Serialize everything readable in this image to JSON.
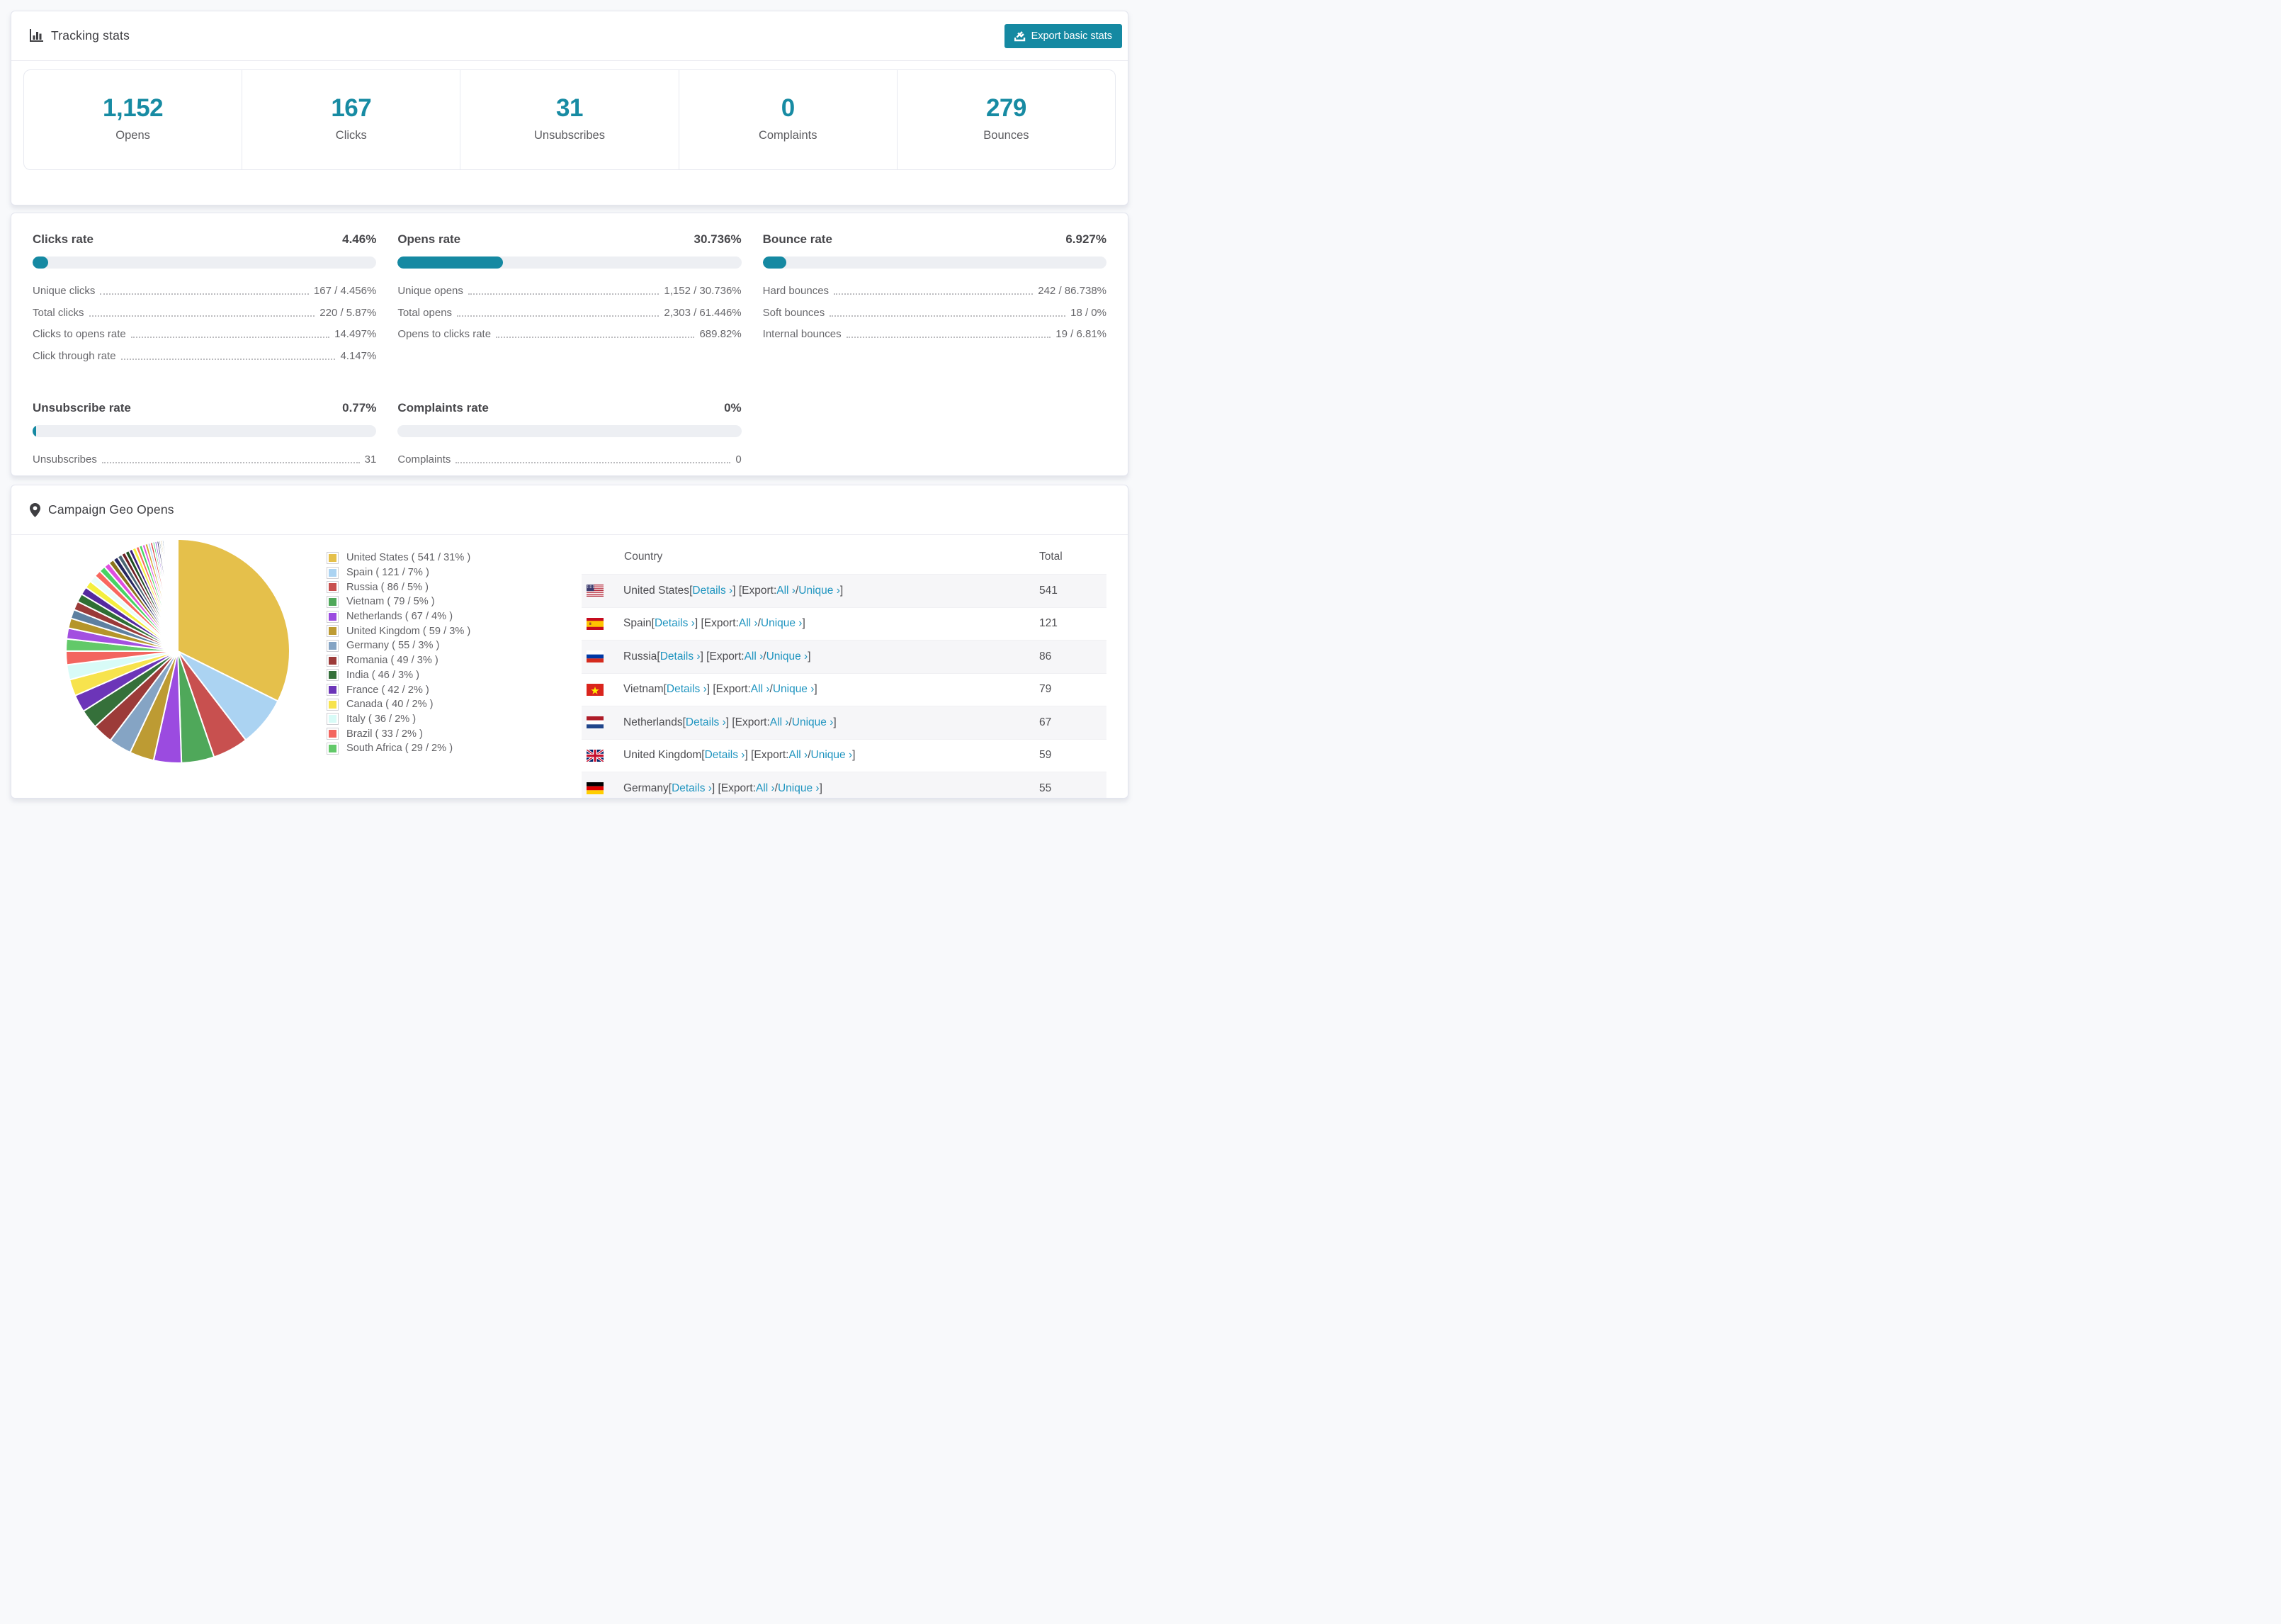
{
  "colors": {
    "accent": "#1589a2",
    "link": "#2095c0",
    "bar_track": "#edeff3",
    "page_bg": "#f8f9fb"
  },
  "tracking": {
    "title": "Tracking stats",
    "export_button": "Export basic stats",
    "stats": [
      {
        "value": "1,152",
        "label": "Opens"
      },
      {
        "value": "167",
        "label": "Clicks"
      },
      {
        "value": "31",
        "label": "Unsubscribes"
      },
      {
        "value": "0",
        "label": "Complaints"
      },
      {
        "value": "279",
        "label": "Bounces"
      }
    ]
  },
  "rates": {
    "sections": [
      {
        "title": "Clicks rate",
        "value": "4.46%",
        "percent": 4.46,
        "rows": [
          {
            "label": "Unique clicks",
            "value": "167 / 4.456%"
          },
          {
            "label": "Total clicks",
            "value": "220 / 5.87%"
          },
          {
            "label": "Clicks to opens rate",
            "value": "14.497%"
          },
          {
            "label": "Click through rate",
            "value": "4.147%"
          }
        ]
      },
      {
        "title": "Opens rate",
        "value": "30.736%",
        "percent": 30.736,
        "rows": [
          {
            "label": "Unique opens",
            "value": "1,152 / 30.736%"
          },
          {
            "label": "Total opens",
            "value": "2,303 / 61.446%"
          },
          {
            "label": "Opens to clicks rate",
            "value": "689.82%"
          }
        ]
      },
      {
        "title": "Bounce rate",
        "value": "6.927%",
        "percent": 6.927,
        "rows": [
          {
            "label": "Hard bounces",
            "value": "242 / 86.738%"
          },
          {
            "label": "Soft bounces",
            "value": "18 / 0%"
          },
          {
            "label": "Internal bounces",
            "value": "19 / 6.81%"
          }
        ]
      },
      {
        "title": "Unsubscribe rate",
        "value": "0.77%",
        "percent": 0.77,
        "rows": [
          {
            "label": "Unsubscribes",
            "value": "31"
          }
        ]
      },
      {
        "title": "Complaints rate",
        "value": "0%",
        "percent": 0,
        "rows": [
          {
            "label": "Complaints",
            "value": "0"
          }
        ]
      }
    ]
  },
  "geo": {
    "title": "Campaign Geo Opens",
    "table": {
      "columns": [
        "Country",
        "Total"
      ],
      "labels": {
        "details": "Details ›",
        "export_prefix": "[Export:",
        "all": "All ›",
        "slash": "/",
        "unique": "Unique ›",
        "bracket_open": "[",
        "bracket_close": "]"
      },
      "rows": [
        {
          "country": "United States",
          "flag": "us",
          "total": "541"
        },
        {
          "country": "Spain",
          "flag": "es",
          "total": "121"
        },
        {
          "country": "Russia",
          "flag": "ru",
          "total": "86"
        },
        {
          "country": "Vietnam",
          "flag": "vn",
          "total": "79"
        },
        {
          "country": "Netherlands",
          "flag": "nl",
          "total": "67"
        },
        {
          "country": "United Kingdom",
          "flag": "gb",
          "total": "59"
        },
        {
          "country": "Germany",
          "flag": "de",
          "total": "55"
        }
      ]
    }
  },
  "chart_data": {
    "type": "pie",
    "title": "Campaign Geo Opens",
    "legend_position": "right",
    "start_angle_deg": -90,
    "slices": [
      {
        "label": "United States",
        "value": 541,
        "pct": "31%",
        "color": "#e5c04b"
      },
      {
        "label": "Spain",
        "value": 121,
        "pct": "7%",
        "color": "#abd3f2"
      },
      {
        "label": "Russia",
        "value": 86,
        "pct": "5%",
        "color": "#c8504f"
      },
      {
        "label": "Vietnam",
        "value": 79,
        "pct": "5%",
        "color": "#4fa85a"
      },
      {
        "label": "Netherlands",
        "value": 67,
        "pct": "4%",
        "color": "#9b4be0"
      },
      {
        "label": "United Kingdom",
        "value": 59,
        "pct": "3%",
        "color": "#bd9b33"
      },
      {
        "label": "Germany",
        "value": 55,
        "pct": "3%",
        "color": "#85a4c4"
      },
      {
        "label": "Romania",
        "value": 49,
        "pct": "3%",
        "color": "#9c3b39"
      },
      {
        "label": "India",
        "value": 46,
        "pct": "3%",
        "color": "#35703a"
      },
      {
        "label": "France",
        "value": 42,
        "pct": "2%",
        "color": "#6c35b8"
      },
      {
        "label": "Canada",
        "value": 40,
        "pct": "2%",
        "color": "#f7e34d"
      },
      {
        "label": "Italy",
        "value": 36,
        "pct": "2%",
        "color": "#d8fbf7"
      },
      {
        "label": "Brazil",
        "value": 33,
        "pct": "2%",
        "color": "#f3655f"
      },
      {
        "label": "South Africa",
        "value": 29,
        "pct": "2%",
        "color": "#62c969"
      }
    ],
    "unlabeled_slices": {
      "values": [
        26,
        24,
        22,
        21,
        20,
        19,
        18,
        17,
        16,
        15,
        14,
        13,
        12,
        11,
        10,
        10,
        9,
        9,
        8,
        8,
        7,
        7,
        6,
        6,
        5,
        5,
        5,
        4,
        4,
        4,
        3,
        3,
        3,
        3,
        2,
        2,
        2,
        2,
        2,
        2,
        1.6,
        1.3,
        1.1,
        0.9,
        0.8,
        0.7,
        0.6,
        0.5,
        0.4,
        0.35,
        0.3,
        0.25,
        0.2,
        0.18,
        0.15,
        0.12,
        0.1
      ],
      "palette": [
        "#a34fe0",
        "#b5952a",
        "#5e80a0",
        "#9a3a38",
        "#2e6f33",
        "#55299f",
        "#f4ef3e",
        "#e9fdfb",
        "#f8675e",
        "#47d463",
        "#df4fdf",
        "#8a731c",
        "#27275f",
        "#4a6572",
        "#6e1f24",
        "#1e4d22",
        "#3b1f7a",
        "#f4ef3e",
        "#f8675e",
        "#47d463",
        "#df4fdf",
        "#d2a62e",
        "#a8d1f0",
        "#dc3b3b",
        "#35d066",
        "#8a4fe0",
        "#27275f",
        "#144150",
        "#b5952a",
        "#5e80a0",
        "#9a3a38",
        "#2e6f33",
        "#55299f",
        "#f4ef3e",
        "#e9fdfb",
        "#f8675e",
        "#47d463",
        "#df4fdf",
        "#d2a62e",
        "#a8d1f0"
      ]
    }
  }
}
